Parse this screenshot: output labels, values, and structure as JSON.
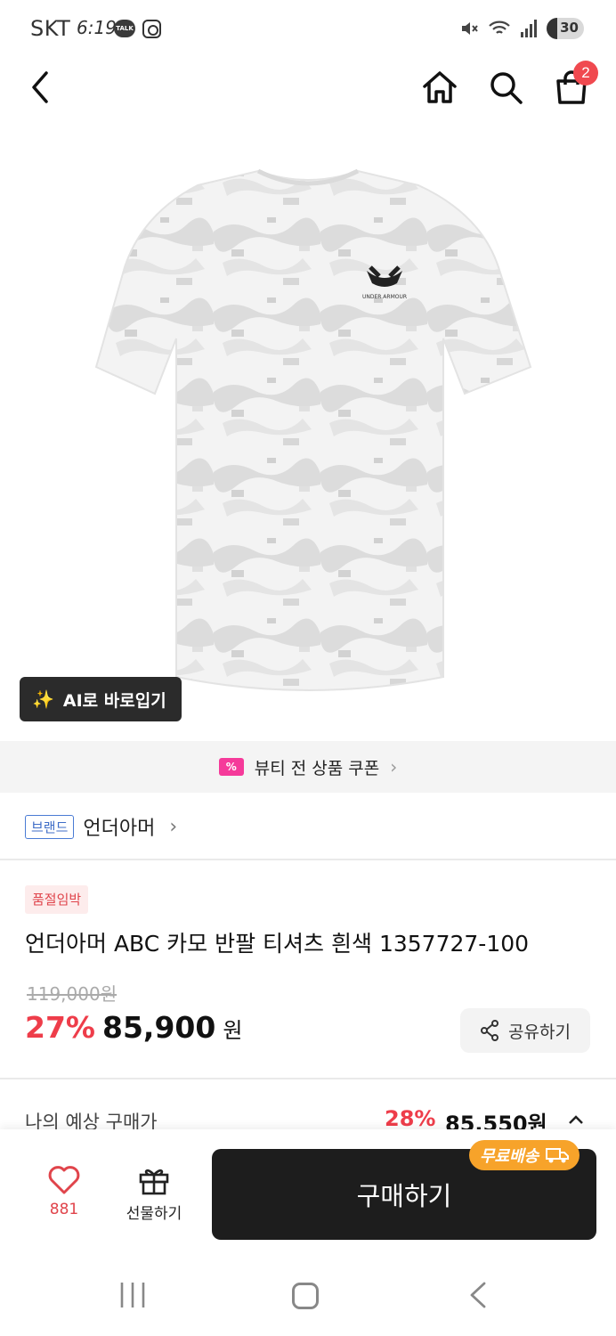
{
  "status_bar": {
    "carrier": "SKT",
    "time": "6:19",
    "talk_badge": "TALK",
    "battery": "30",
    "icons": [
      "kakaotalk-icon",
      "instagram-icon",
      "mute-icon",
      "wifi-icon",
      "signal-icon",
      "battery-icon"
    ]
  },
  "nav": {
    "cart_count": "2",
    "icons": [
      "back-arrow-icon",
      "home-icon",
      "search-icon",
      "shopping-bag-icon"
    ]
  },
  "product_image": {
    "brand_mark_text": "UNDER ARMOUR",
    "ai_button_label": "AI로 바로입기"
  },
  "coupon_banner": {
    "label": "뷰티 전 상품 쿠폰",
    "icon_text": "%",
    "color": "#f53a9a"
  },
  "brand": {
    "tag": "브랜드",
    "name": "언더아머"
  },
  "product": {
    "badge": "품절임박",
    "title": "언더아머 ABC 카모 반팔 티셔츠 흰색 1357727-100",
    "original_price": "119,000원",
    "discount": "27%",
    "price": "85,900",
    "currency": "원",
    "share_label": "공유하기"
  },
  "expected": {
    "label": "나의 예상 구매가",
    "discount": "28%",
    "price": "85,550원"
  },
  "bottom_bar": {
    "like_count": "881",
    "gift_label": "선물하기",
    "buy_label": "구매하기",
    "free_shipping": "무료배송",
    "accent_color": "#f7a32a"
  },
  "colors": {
    "discount_red": "#ee3d4a",
    "buy_button": "#1d1d1d",
    "badge_red": "#f0494f"
  }
}
